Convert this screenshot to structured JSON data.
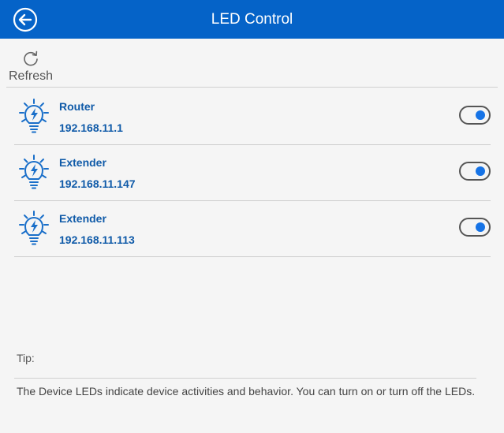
{
  "header": {
    "title": "LED Control",
    "back_icon": "arrow-left-circle-icon"
  },
  "toolbar": {
    "refresh_label": "Refresh",
    "refresh_icon": "refresh-icon"
  },
  "devices": [
    {
      "name": "Router",
      "ip": "192.168.11.1",
      "led_on": true
    },
    {
      "name": "Extender",
      "ip": "192.168.11.147",
      "led_on": true
    },
    {
      "name": "Extender",
      "ip": "192.168.11.113",
      "led_on": true
    }
  ],
  "tip": {
    "label": "Tip:",
    "text": "The Device LEDs indicate device activities and behavior. You can turn on or turn off the LEDs."
  },
  "colors": {
    "header_bg": "#0563c8",
    "accent": "#1673e6",
    "device_text": "#0f5aa8"
  }
}
